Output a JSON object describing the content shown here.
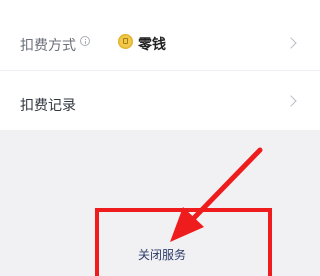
{
  "payment_method": {
    "label": "扣费方式",
    "value": "零钱"
  },
  "deduction_records": {
    "label": "扣费记录"
  },
  "close_service": {
    "label": "关闭服务"
  },
  "colors": {
    "annotation_red": "#ee1c1c",
    "coin_gold": "#f1c84a",
    "link_blue": "#2e3c69"
  },
  "icons": [
    "info-icon",
    "coin-icon",
    "chevron-right-icon"
  ]
}
